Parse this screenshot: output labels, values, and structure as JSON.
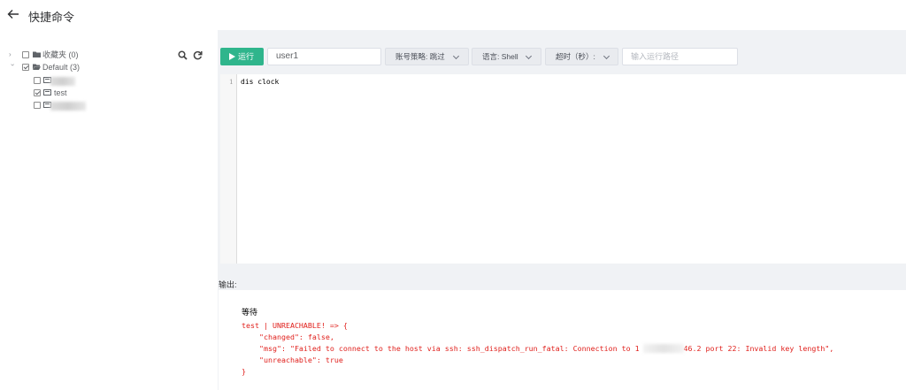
{
  "header": {
    "title": "快捷命令",
    "back_icon": "arrow-left-icon"
  },
  "tree": {
    "favorites": {
      "label": "收藏夹",
      "count": "(0)"
    },
    "default_group": {
      "label": "Default",
      "count": "(3)",
      "checked": true
    },
    "hosts": [
      {
        "label": "",
        "checked": false,
        "redacted": true
      },
      {
        "label": "test",
        "checked": true,
        "redacted": false
      },
      {
        "label": "",
        "checked": false,
        "redacted": true
      }
    ],
    "tools": [
      "search-icon",
      "refresh-icon"
    ]
  },
  "toolbar": {
    "run_label": "运行",
    "user_value": "user1",
    "account_policy": "账号策略: 跳过",
    "language": "语言: Shell",
    "timeout": "超时（秒）:",
    "path_placeholder": "输入运行路径"
  },
  "editor": {
    "line_numbers": [
      "1"
    ],
    "lines": [
      "dis clock"
    ]
  },
  "output": {
    "label": "输出:",
    "status": "等待",
    "lines": [
      "test | UNREACHABLE! => {",
      "    \"changed\": false,",
      "    \"msg\": \"Failed to connect to the host via ssh: ssh_dispatch_run_fatal: Connection to 1          46.2 port 22: Invalid key length\",",
      "    \"unreachable\": true",
      "}"
    ]
  },
  "colors": {
    "accent": "#2fb58c",
    "error": "#e0201c"
  }
}
